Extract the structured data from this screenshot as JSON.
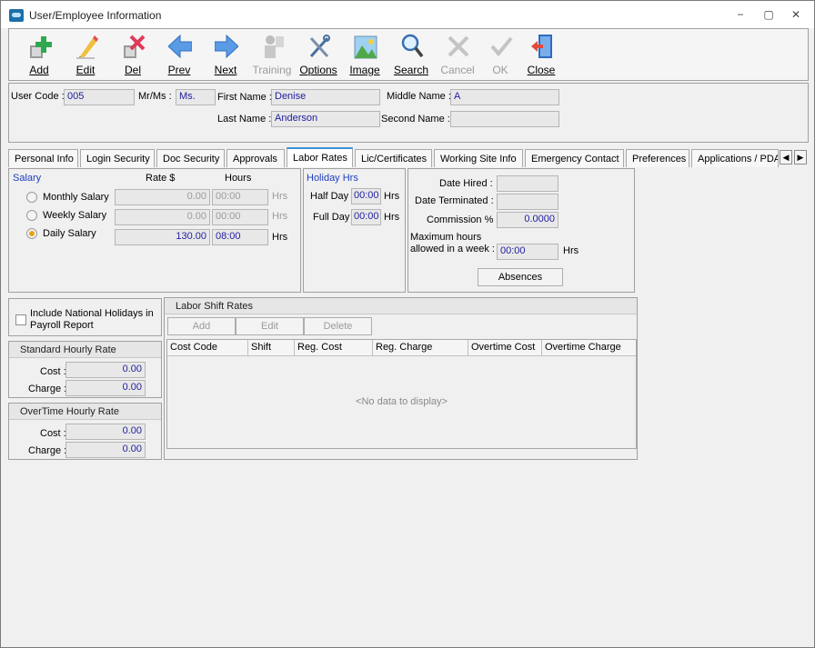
{
  "window": {
    "title": "User/Employee Information",
    "controls": [
      "−",
      "▢",
      "✕"
    ]
  },
  "toolbar": {
    "add": "Add",
    "edit": "Edit",
    "del": "Del",
    "prev": "Prev",
    "next": "Next",
    "training": "Training",
    "options": "Options",
    "image": "Image",
    "search": "Search",
    "cancel": "Cancel",
    "ok": "OK",
    "close": "Close"
  },
  "header": {
    "user_code_label": "User Code :",
    "user_code": "005",
    "mr_ms_label": "Mr/Ms :",
    "mr_ms": "Ms.",
    "first_name_label": "First Name :",
    "first_name": "Denise",
    "middle_name_label": "Middle Name :",
    "middle_name": "A",
    "last_name_label": "Last Name :",
    "last_name": "Anderson",
    "second_name_label": "Second Name :",
    "second_name": ""
  },
  "tabs": [
    "Personal Info",
    "Login Security",
    "Doc Security",
    "Approvals",
    "Labor Rates",
    "Lic/Certificates",
    "Working Site Info",
    "Emergency Contact",
    "Preferences",
    "Applications / PDA"
  ],
  "tab_nav": {
    "left": "◀",
    "right": "▶"
  },
  "salary": {
    "title": "Salary",
    "rate_header": "Rate $",
    "hours_header": "Hours",
    "rows": [
      {
        "label": "Monthly Salary",
        "rate": "0.00",
        "hours": "00:00",
        "unit": "Hrs"
      },
      {
        "label": "Weekly Salary",
        "rate": "0.00",
        "hours": "00:00",
        "unit": "Hrs"
      },
      {
        "label": "Daily Salary",
        "rate": "130.00",
        "hours": "08:00",
        "unit": "Hrs"
      }
    ]
  },
  "holiday": {
    "title": "Holiday Hrs",
    "half_day_label": "Half Day",
    "half_day": "00:00",
    "full_day_label": "Full Day",
    "full_day": "00:00",
    "unit": "Hrs"
  },
  "dates": {
    "date_hired_label": "Date Hired :",
    "date_hired": "",
    "date_terminated_label": "Date Terminated :",
    "date_terminated": "",
    "commission_label": "Commission % :",
    "commission": "0.0000",
    "max_hours_label_1": "Maximum hours",
    "max_hours_label_2": "allowed in a week :",
    "max_hours": "00:00",
    "max_hours_unit": "Hrs",
    "absences_button": "Absences"
  },
  "include_holidays": {
    "label_1": "Include National Holidays in",
    "label_2": "Payroll Report"
  },
  "standard_rate": {
    "title": "Standard Hourly Rate",
    "cost_label": "Cost :",
    "cost": "0.00",
    "charge_label": "Charge :",
    "charge": "0.00"
  },
  "overtime_rate": {
    "title": "OverTime Hourly Rate",
    "cost_label": "Cost :",
    "cost": "0.00",
    "charge_label": "Charge :",
    "charge": "0.00"
  },
  "labor_shift": {
    "title": "Labor Shift Rates",
    "add": "Add",
    "edit": "Edit",
    "delete": "Delete",
    "columns": [
      "Cost Code",
      "Shift",
      "Reg. Cost",
      "Reg. Charge",
      "Overtime Cost",
      "Overtime Charge"
    ],
    "empty": "<No data to display>"
  }
}
